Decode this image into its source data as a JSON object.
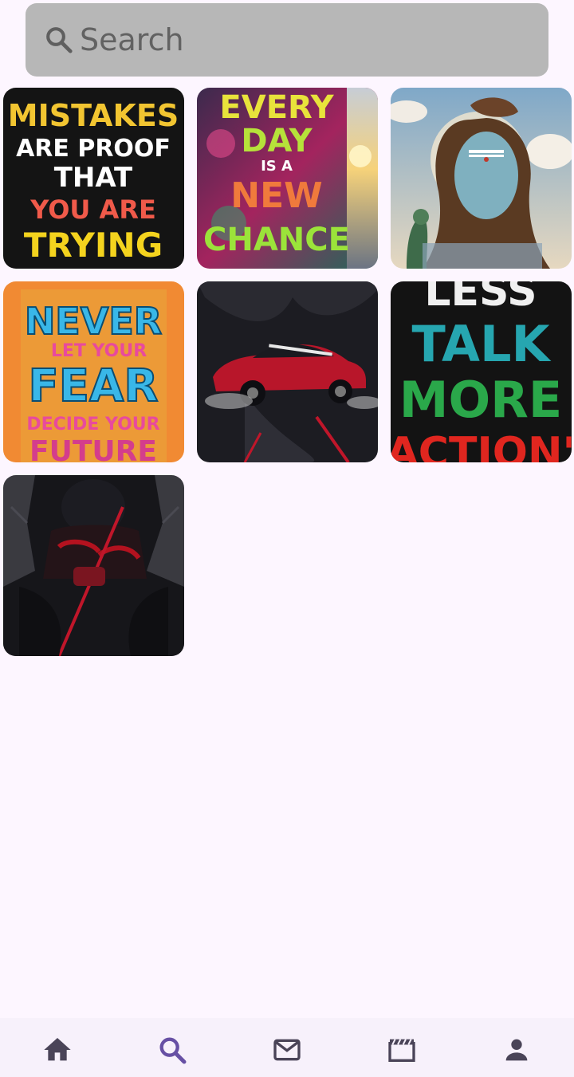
{
  "search": {
    "placeholder": "Search",
    "value": ""
  },
  "grid": {
    "tiles": [
      {
        "name": "poster-mistakes",
        "lines": [
          "MISTAKES",
          "ARE PROOF",
          "THAT",
          "YOU ARE",
          "TRYING"
        ]
      },
      {
        "name": "poster-every-day",
        "lines": [
          "EVERY",
          "DAY",
          "IS A",
          "NEW",
          "CHANCE"
        ]
      },
      {
        "name": "poster-shiva",
        "lines": []
      },
      {
        "name": "poster-never-fear",
        "lines": [
          "NEVER",
          "LET YOUR",
          "FEAR",
          "DECIDE YOUR",
          "FUTURE"
        ]
      },
      {
        "name": "poster-red-car",
        "lines": []
      },
      {
        "name": "poster-less-talk",
        "lines": [
          "LESS",
          "TALK",
          "MORE",
          "ACTION'"
        ]
      },
      {
        "name": "poster-dark-warrior",
        "lines": []
      }
    ]
  },
  "bottom_nav": {
    "items": [
      {
        "icon": "home-icon",
        "active": false
      },
      {
        "icon": "search-icon",
        "active": true
      },
      {
        "icon": "mail-icon",
        "active": false
      },
      {
        "icon": "clapperboard-icon",
        "active": false
      },
      {
        "icon": "person-icon",
        "active": false
      }
    ],
    "colors": {
      "inactive": "#4a4458",
      "active": "#6750a4"
    }
  },
  "colors": {
    "background": "#fdf6ff",
    "search_bar": "#b7b7b7"
  }
}
